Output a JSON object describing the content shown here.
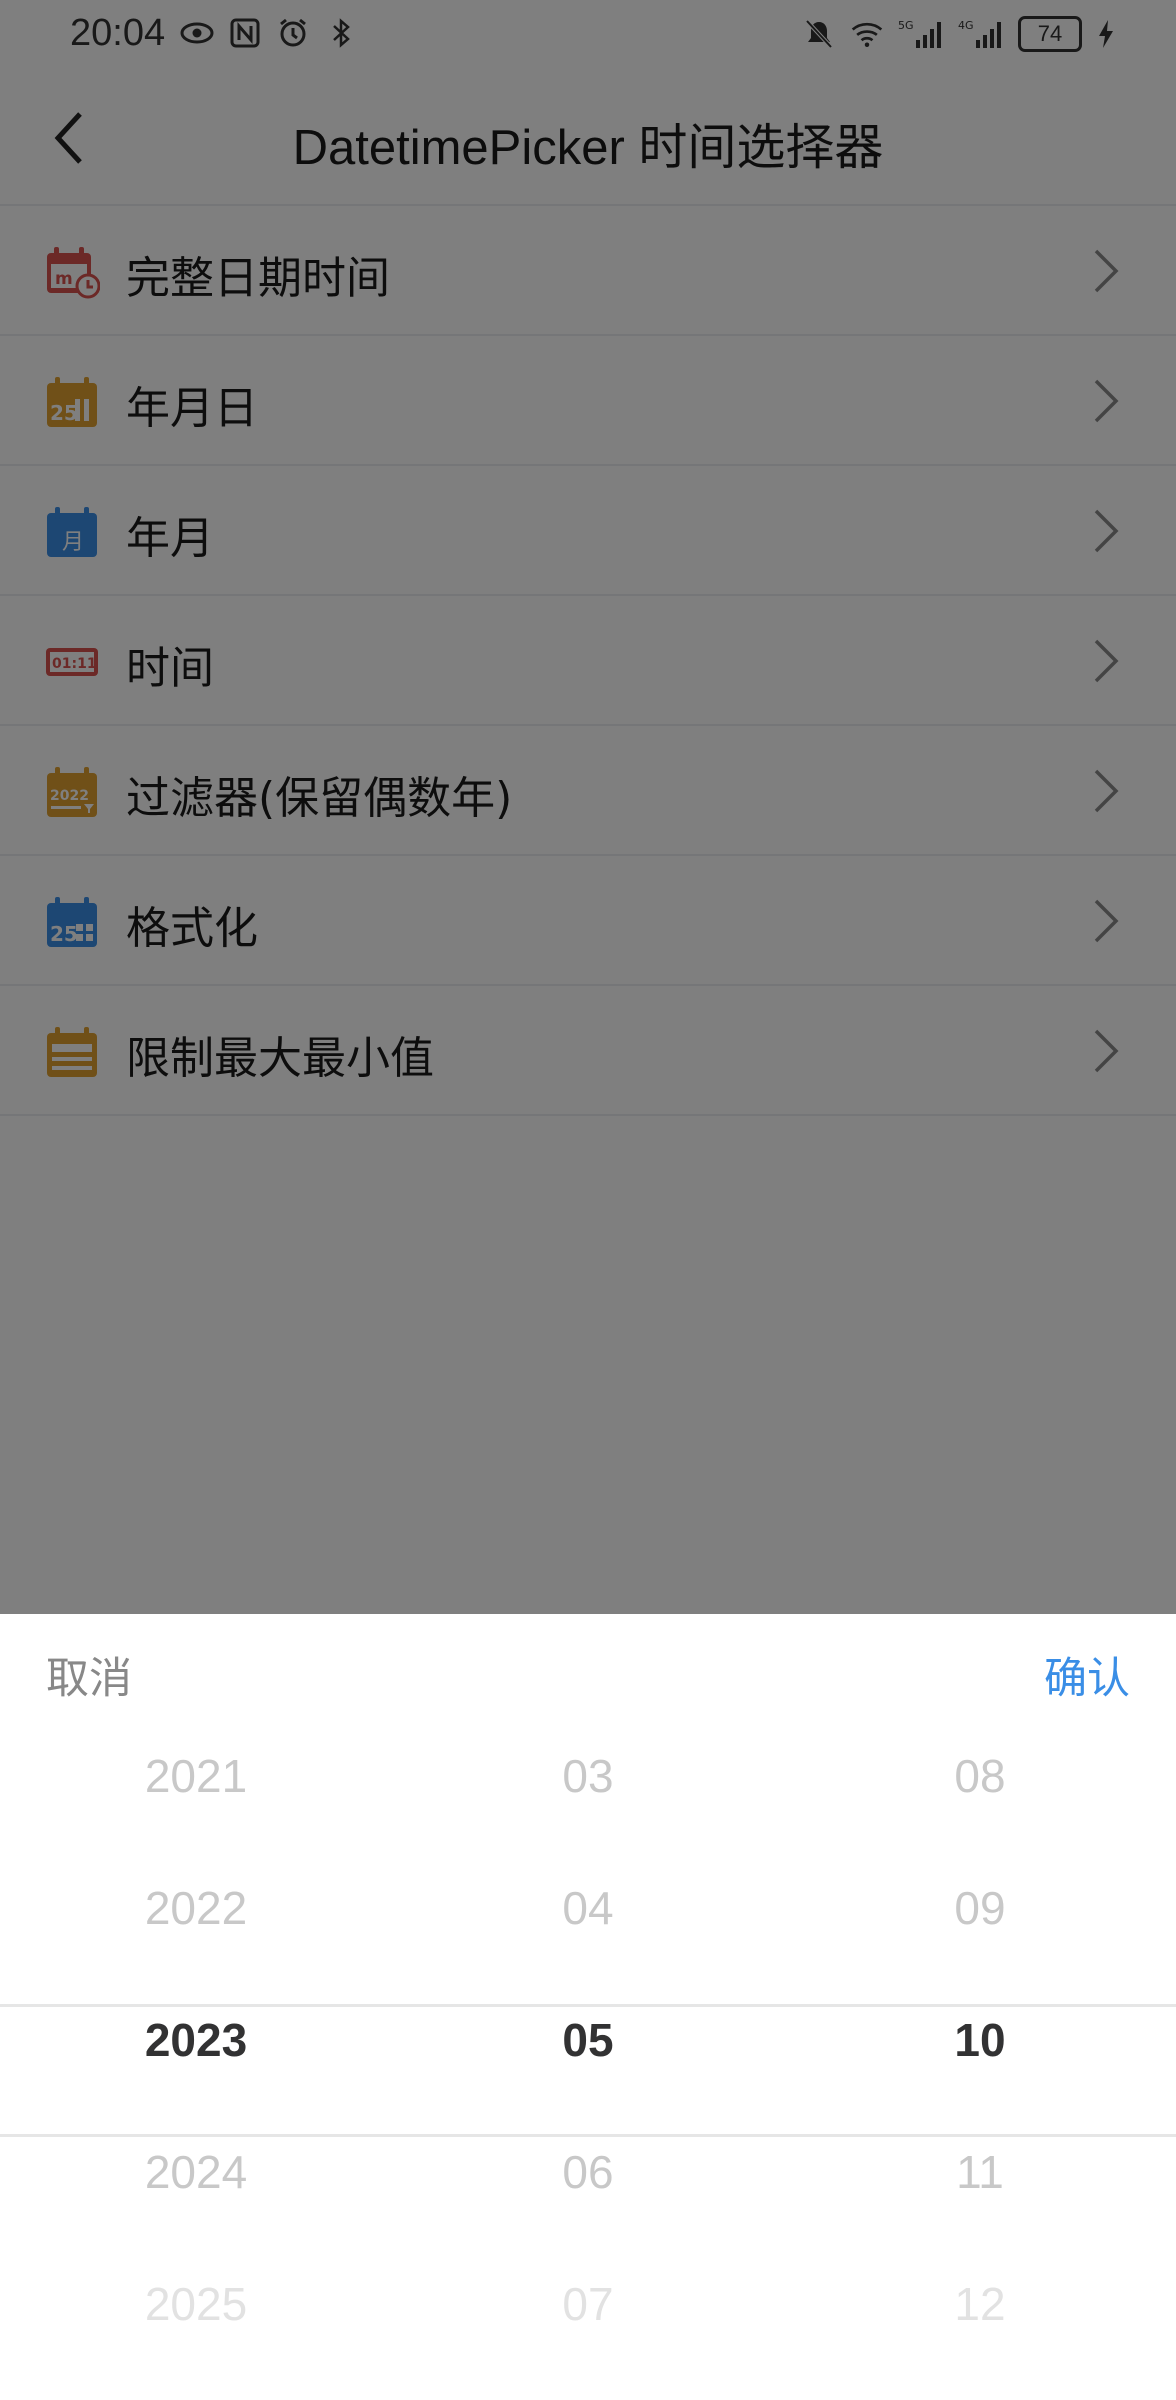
{
  "status_bar": {
    "time": "20:04",
    "battery": "74",
    "left_icons": [
      "eye-icon",
      "nfc-icon",
      "alarm-icon",
      "bluetooth-icon"
    ],
    "right_icons": [
      "mute-icon",
      "wifi-icon",
      "5g-signal-icon",
      "4g-signal-icon",
      "battery-icon",
      "charging-icon"
    ]
  },
  "navbar": {
    "title": "DatetimePicker 时间选择器",
    "back_icon": "chevron-left-icon"
  },
  "list": {
    "items": [
      {
        "label": "完整日期时间",
        "icon": "datetime-calendar-icon",
        "color": "#d9534f"
      },
      {
        "label": "年月日",
        "icon": "date-calendar-icon",
        "color": "#e0a030"
      },
      {
        "label": "年月",
        "icon": "month-calendar-icon",
        "color": "#3a8ee6"
      },
      {
        "label": "时间",
        "icon": "time-display-icon",
        "color": "#d9534f"
      },
      {
        "label": "过滤器(保留偶数年)",
        "icon": "filter-calendar-icon",
        "color": "#e0a030"
      },
      {
        "label": "格式化",
        "icon": "format-calendar-icon",
        "color": "#3a8ee6"
      },
      {
        "label": "限制最大最小值",
        "icon": "range-calendar-icon",
        "color": "#e0a030"
      }
    ]
  },
  "picker": {
    "cancel_label": "取消",
    "confirm_label": "确认",
    "confirm_color": "#3a8ee6",
    "columns": [
      {
        "name": "year",
        "options": [
          "2021",
          "2022",
          "2023",
          "2024",
          "2025"
        ],
        "selected": "2023"
      },
      {
        "name": "month",
        "options": [
          "03",
          "04",
          "05",
          "06",
          "07"
        ],
        "selected": "05"
      },
      {
        "name": "day",
        "options": [
          "08",
          "09",
          "10",
          "11",
          "12"
        ],
        "selected": "10"
      }
    ]
  }
}
